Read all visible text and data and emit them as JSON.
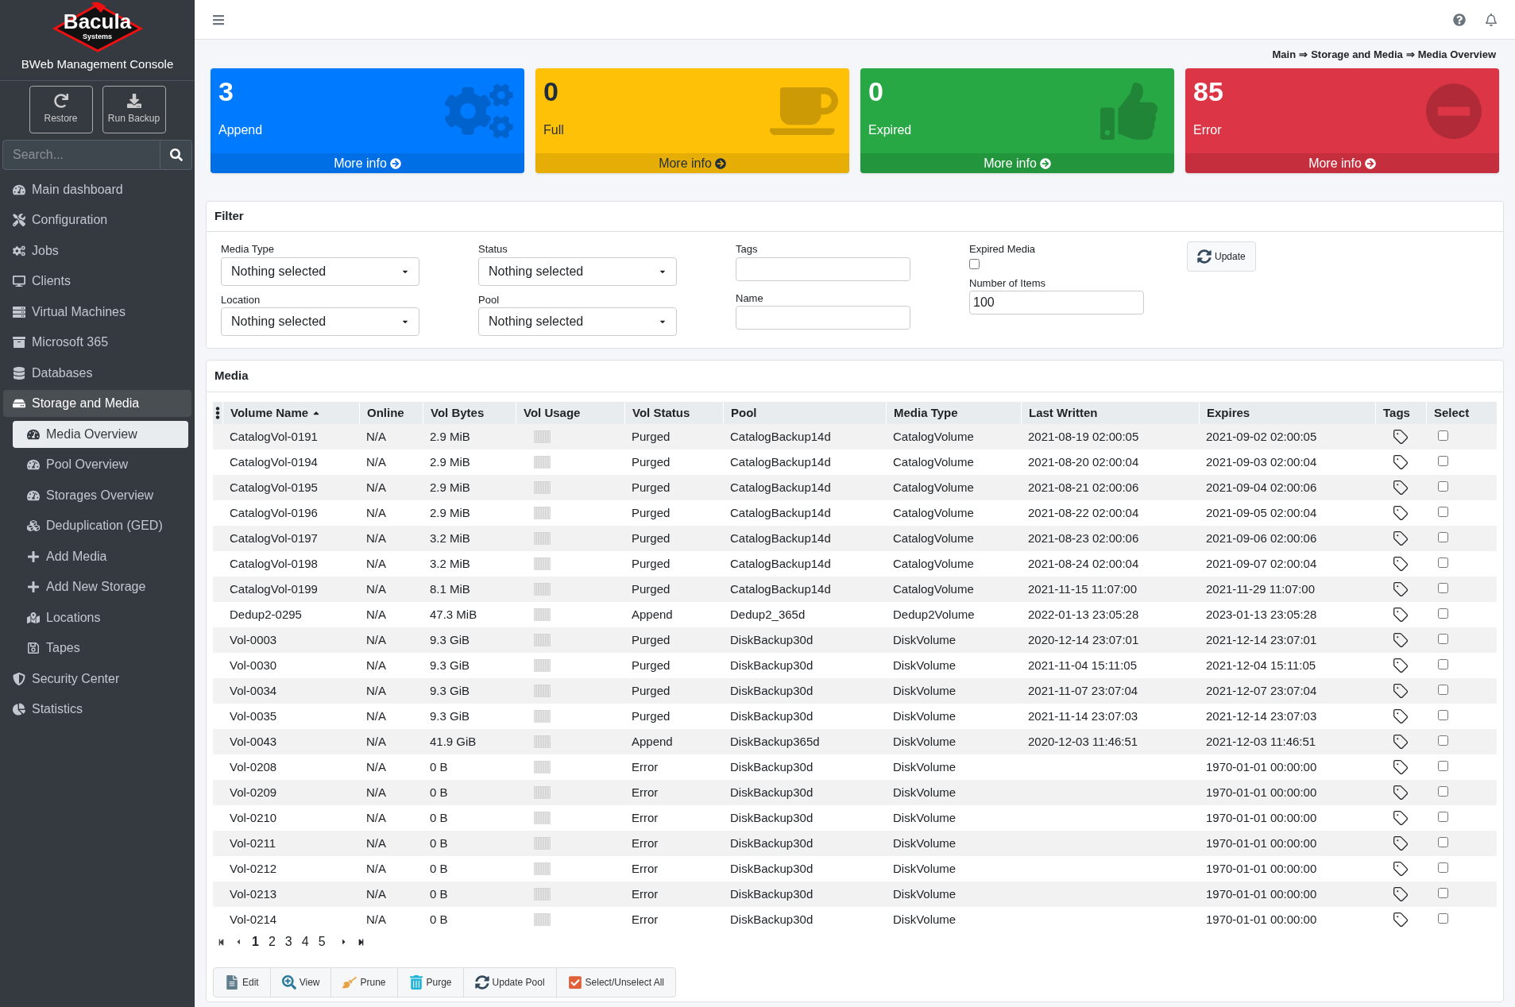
{
  "sidebar": {
    "logo": {
      "name": "Bacula",
      "sub": "Systems"
    },
    "title": "BWeb Management Console",
    "actions": [
      {
        "label": "Restore"
      },
      {
        "label": "Run Backup"
      }
    ],
    "search": {
      "placeholder": "Search..."
    },
    "items": [
      {
        "label": "Main dashboard",
        "selected": false
      },
      {
        "label": "Configuration",
        "selected": false
      },
      {
        "label": "Jobs",
        "selected": false
      },
      {
        "label": "Clients",
        "selected": false
      },
      {
        "label": "Virtual Machines",
        "selected": false
      },
      {
        "label": "Microsoft 365",
        "selected": false
      },
      {
        "label": "Databases",
        "selected": false
      },
      {
        "label": "Storage and Media",
        "selected": true,
        "children": [
          {
            "label": "Media Overview",
            "selected": true
          },
          {
            "label": "Pool Overview",
            "selected": false
          },
          {
            "label": "Storages Overview",
            "selected": false
          },
          {
            "label": "Deduplication (GED)",
            "selected": false
          },
          {
            "label": "Add Media",
            "selected": false
          },
          {
            "label": "Add New Storage",
            "selected": false
          },
          {
            "label": "Locations",
            "selected": false
          },
          {
            "label": "Tapes",
            "selected": false
          }
        ]
      },
      {
        "label": "Security Center",
        "selected": false
      },
      {
        "label": "Statistics",
        "selected": false
      }
    ]
  },
  "breadcrumb": {
    "separator": "⇒",
    "items": [
      "Main",
      "Storage and Media",
      "Media Overview"
    ]
  },
  "cards": [
    {
      "count": "3",
      "label": "Append",
      "link": "More info",
      "color": "#007bff"
    },
    {
      "count": "0",
      "label": "Full",
      "link": "More info",
      "color": "#ffc107"
    },
    {
      "count": "0",
      "label": "Expired",
      "link": "More info",
      "color": "#28a745"
    },
    {
      "count": "85",
      "label": "Error",
      "link": "More info",
      "color": "#dc3545"
    }
  ],
  "filter": {
    "title": "Filter",
    "selects": [
      {
        "label": "Media Type",
        "value": "Nothing selected"
      },
      {
        "label": "Status",
        "value": "Nothing selected"
      },
      {
        "label": "Location",
        "value": "Nothing selected"
      },
      {
        "label": "Pool",
        "value": "Nothing selected"
      }
    ],
    "tags": {
      "label": "Tags"
    },
    "name": {
      "label": "Name"
    },
    "expired": {
      "label": "Expired Media",
      "checked": false
    },
    "items": {
      "label": "Number of Items",
      "value": "100"
    },
    "update": "Update"
  },
  "media": {
    "title": "Media",
    "columns": [
      "Volume Name",
      "Online",
      "Vol Bytes",
      "Vol Usage",
      "Vol Status",
      "Pool",
      "Media Type",
      "Last Written",
      "Expires",
      "Tags",
      "Select"
    ],
    "rows": [
      {
        "cells": [
          "CatalogVol-0191",
          "N/A",
          "2.9 MiB",
          "",
          "Purged",
          "CatalogBackup14d",
          "CatalogVolume",
          "2021-08-19 02:00:05",
          "2021-09-02 02:00:05"
        ],
        "checked": false
      },
      {
        "cells": [
          "CatalogVol-0194",
          "N/A",
          "2.9 MiB",
          "",
          "Purged",
          "CatalogBackup14d",
          "CatalogVolume",
          "2021-08-20 02:00:04",
          "2021-09-03 02:00:04"
        ],
        "checked": false
      },
      {
        "cells": [
          "CatalogVol-0195",
          "N/A",
          "2.9 MiB",
          "",
          "Purged",
          "CatalogBackup14d",
          "CatalogVolume",
          "2021-08-21 02:00:06",
          "2021-09-04 02:00:06"
        ],
        "checked": false
      },
      {
        "cells": [
          "CatalogVol-0196",
          "N/A",
          "2.9 MiB",
          "",
          "Purged",
          "CatalogBackup14d",
          "CatalogVolume",
          "2021-08-22 02:00:04",
          "2021-09-05 02:00:04"
        ],
        "checked": false
      },
      {
        "cells": [
          "CatalogVol-0197",
          "N/A",
          "3.2 MiB",
          "",
          "Purged",
          "CatalogBackup14d",
          "CatalogVolume",
          "2021-08-23 02:00:06",
          "2021-09-06 02:00:06"
        ],
        "checked": false
      },
      {
        "cells": [
          "CatalogVol-0198",
          "N/A",
          "3.2 MiB",
          "",
          "Purged",
          "CatalogBackup14d",
          "CatalogVolume",
          "2021-08-24 02:00:04",
          "2021-09-07 02:00:04"
        ],
        "checked": false
      },
      {
        "cells": [
          "CatalogVol-0199",
          "N/A",
          "8.1 MiB",
          "",
          "Purged",
          "CatalogBackup14d",
          "CatalogVolume",
          "2021-11-15 11:07:00",
          "2021-11-29 11:07:00"
        ],
        "checked": false
      },
      {
        "cells": [
          "Dedup2-0295",
          "N/A",
          "47.3 MiB",
          "",
          "Append",
          "Dedup2_365d",
          "Dedup2Volume",
          "2022-01-13 23:05:28",
          "2023-01-13 23:05:28"
        ],
        "checked": false
      },
      {
        "cells": [
          "Vol-0003",
          "N/A",
          "9.3 GiB",
          "",
          "Purged",
          "DiskBackup30d",
          "DiskVolume",
          "2020-12-14 23:07:01",
          "2021-12-14 23:07:01"
        ],
        "checked": false
      },
      {
        "cells": [
          "Vol-0030",
          "N/A",
          "9.3 GiB",
          "",
          "Purged",
          "DiskBackup30d",
          "DiskVolume",
          "2021-11-04 15:11:05",
          "2021-12-04 15:11:05"
        ],
        "checked": false
      },
      {
        "cells": [
          "Vol-0034",
          "N/A",
          "9.3 GiB",
          "",
          "Purged",
          "DiskBackup30d",
          "DiskVolume",
          "2021-11-07 23:07:04",
          "2021-12-07 23:07:04"
        ],
        "checked": false
      },
      {
        "cells": [
          "Vol-0035",
          "N/A",
          "9.3 GiB",
          "",
          "Purged",
          "DiskBackup30d",
          "DiskVolume",
          "2021-11-14 23:07:03",
          "2021-12-14 23:07:03"
        ],
        "checked": false
      },
      {
        "cells": [
          "Vol-0043",
          "N/A",
          "41.9 GiB",
          "",
          "Append",
          "DiskBackup365d",
          "DiskVolume",
          "2020-12-03 11:46:51",
          "2021-12-03 11:46:51"
        ],
        "checked": false
      },
      {
        "cells": [
          "Vol-0208",
          "N/A",
          "0 B",
          "",
          "Error",
          "DiskBackup30d",
          "DiskVolume",
          "",
          "1970-01-01 00:00:00"
        ],
        "checked": false
      },
      {
        "cells": [
          "Vol-0209",
          "N/A",
          "0 B",
          "",
          "Error",
          "DiskBackup30d",
          "DiskVolume",
          "",
          "1970-01-01 00:00:00"
        ],
        "checked": false
      },
      {
        "cells": [
          "Vol-0210",
          "N/A",
          "0 B",
          "",
          "Error",
          "DiskBackup30d",
          "DiskVolume",
          "",
          "1970-01-01 00:00:00"
        ],
        "checked": false
      },
      {
        "cells": [
          "Vol-0211",
          "N/A",
          "0 B",
          "",
          "Error",
          "DiskBackup30d",
          "DiskVolume",
          "",
          "1970-01-01 00:00:00"
        ],
        "checked": false
      },
      {
        "cells": [
          "Vol-0212",
          "N/A",
          "0 B",
          "",
          "Error",
          "DiskBackup30d",
          "DiskVolume",
          "",
          "1970-01-01 00:00:00"
        ],
        "checked": false
      },
      {
        "cells": [
          "Vol-0213",
          "N/A",
          "0 B",
          "",
          "Error",
          "DiskBackup30d",
          "DiskVolume",
          "",
          "1970-01-01 00:00:00"
        ],
        "checked": false
      },
      {
        "cells": [
          "Vol-0214",
          "N/A",
          "0 B",
          "",
          "Error",
          "DiskBackup30d",
          "DiskVolume",
          "",
          "1970-01-01 00:00:00"
        ],
        "checked": false
      }
    ],
    "pages": [
      {
        "label": "1",
        "selected": true
      },
      {
        "label": "2",
        "selected": false
      },
      {
        "label": "3",
        "selected": false
      },
      {
        "label": "4",
        "selected": false
      },
      {
        "label": "5",
        "selected": false
      }
    ],
    "actions": [
      "Edit",
      "View",
      "Prune",
      "Purge",
      "Update Pool",
      "Select/Unselect All"
    ]
  }
}
